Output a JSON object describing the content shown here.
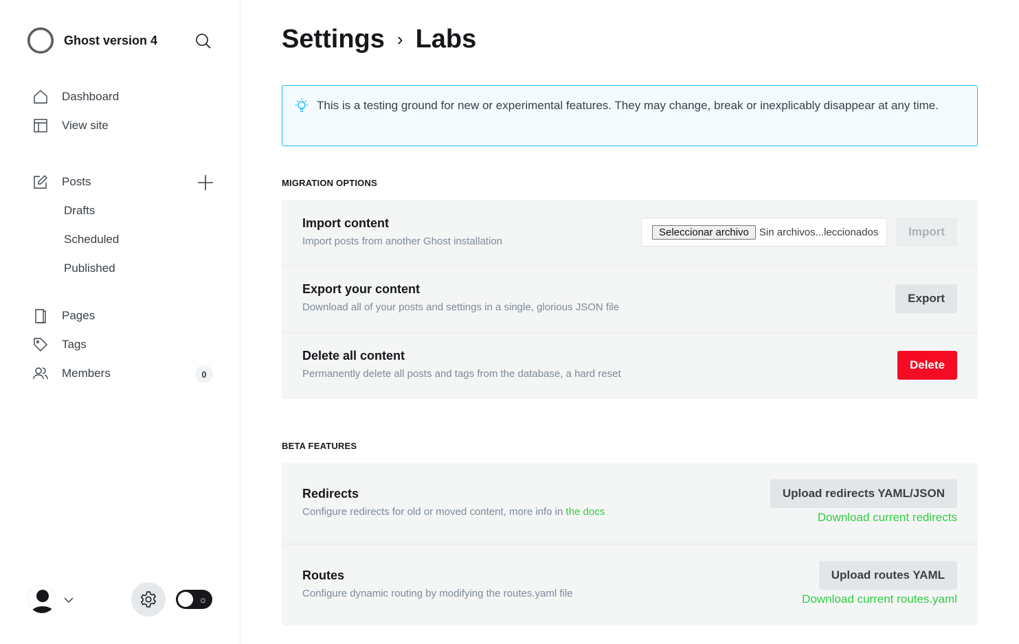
{
  "sidebar": {
    "site_name": "Ghost version 4",
    "items": {
      "dashboard": "Dashboard",
      "view_site": "View site",
      "posts": "Posts",
      "drafts": "Drafts",
      "scheduled": "Scheduled",
      "published": "Published",
      "pages": "Pages",
      "tags": "Tags",
      "members": "Members"
    },
    "members_count": "0"
  },
  "header": {
    "crumb": "Settings",
    "title": "Labs"
  },
  "notice": "This is a testing ground for new or experimental features. They may change, break or inexplicably disappear at any time.",
  "migration": {
    "heading": "MIGRATION OPTIONS",
    "import": {
      "title": "Import content",
      "desc": "Import posts from another Ghost installation",
      "file_button": "Seleccionar archivo",
      "file_status": "Sin archivos...leccionados",
      "button": "Import"
    },
    "export": {
      "title": "Export your content",
      "desc": "Download all of your posts and settings in a single, glorious JSON file",
      "button": "Export"
    },
    "delete": {
      "title": "Delete all content",
      "desc": "Permanently delete all posts and tags from the database, a hard reset",
      "button": "Delete"
    }
  },
  "beta": {
    "heading": "BETA FEATURES",
    "redirects": {
      "title": "Redirects",
      "desc": "Configure redirects for old or moved content, more info in ",
      "docs_link": "the docs",
      "button": "Upload redirects YAML/JSON",
      "download": "Download current redirects"
    },
    "routes": {
      "title": "Routes",
      "desc": "Configure dynamic routing by modifying the routes.yaml file",
      "button": "Upload routes YAML",
      "download": "Download current routes.yaml"
    }
  }
}
